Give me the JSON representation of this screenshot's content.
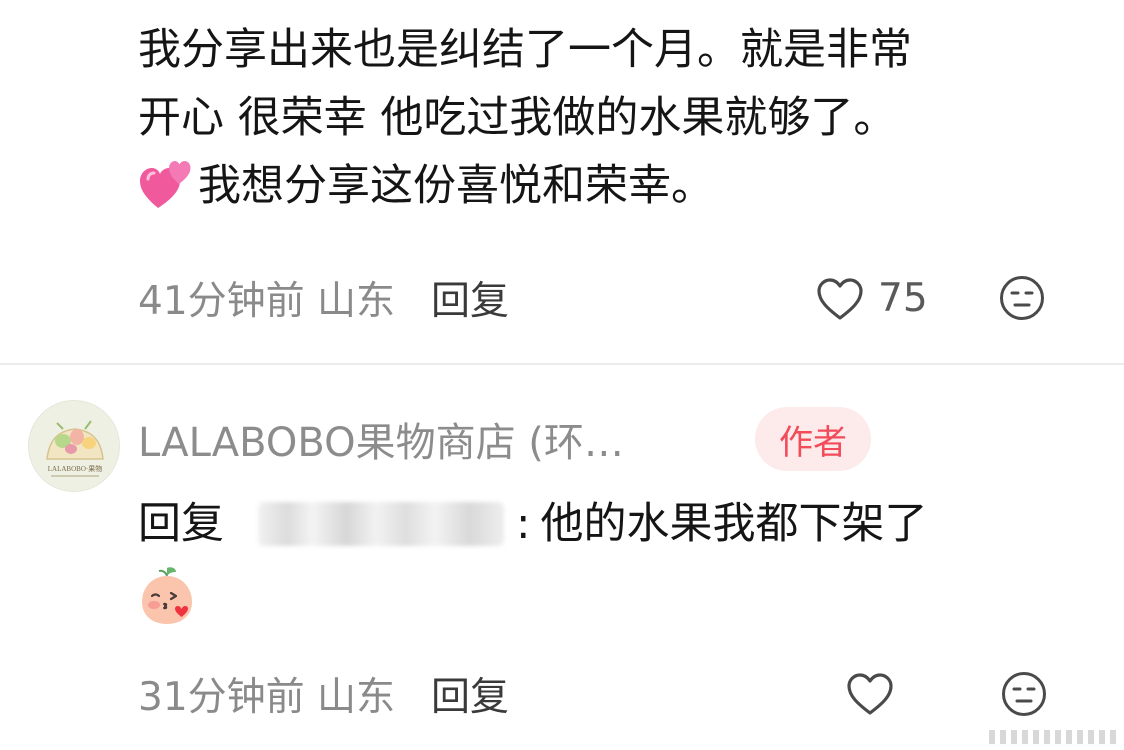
{
  "comment1": {
    "lines": [
      "我分享出来也是纠结了一个月。就是非常",
      "开心 很荣幸 他吃过我做的水果就够了。",
      "我想分享这份喜悦和荣幸。"
    ],
    "emoji": "two-hearts-icon",
    "time_location": "41分钟前 山东",
    "reply_label": "回复",
    "like_count": "75"
  },
  "comment2": {
    "author": "LALABOBO果物商店 (环…",
    "badge": "作者",
    "avatar_text": "LALABOBO·果物",
    "reply_prefix": "回复",
    "reply_target": "",
    "colon": ":",
    "text": "他的水果我都下架了",
    "emoji": "peach-kiss-icon",
    "time_location": "31分钟前 山东",
    "reply_label": "回复"
  },
  "colors": {
    "badge_text": "#f24b5a",
    "badge_bg": "#fdeaea",
    "meta_gray": "#8a8a8a"
  }
}
